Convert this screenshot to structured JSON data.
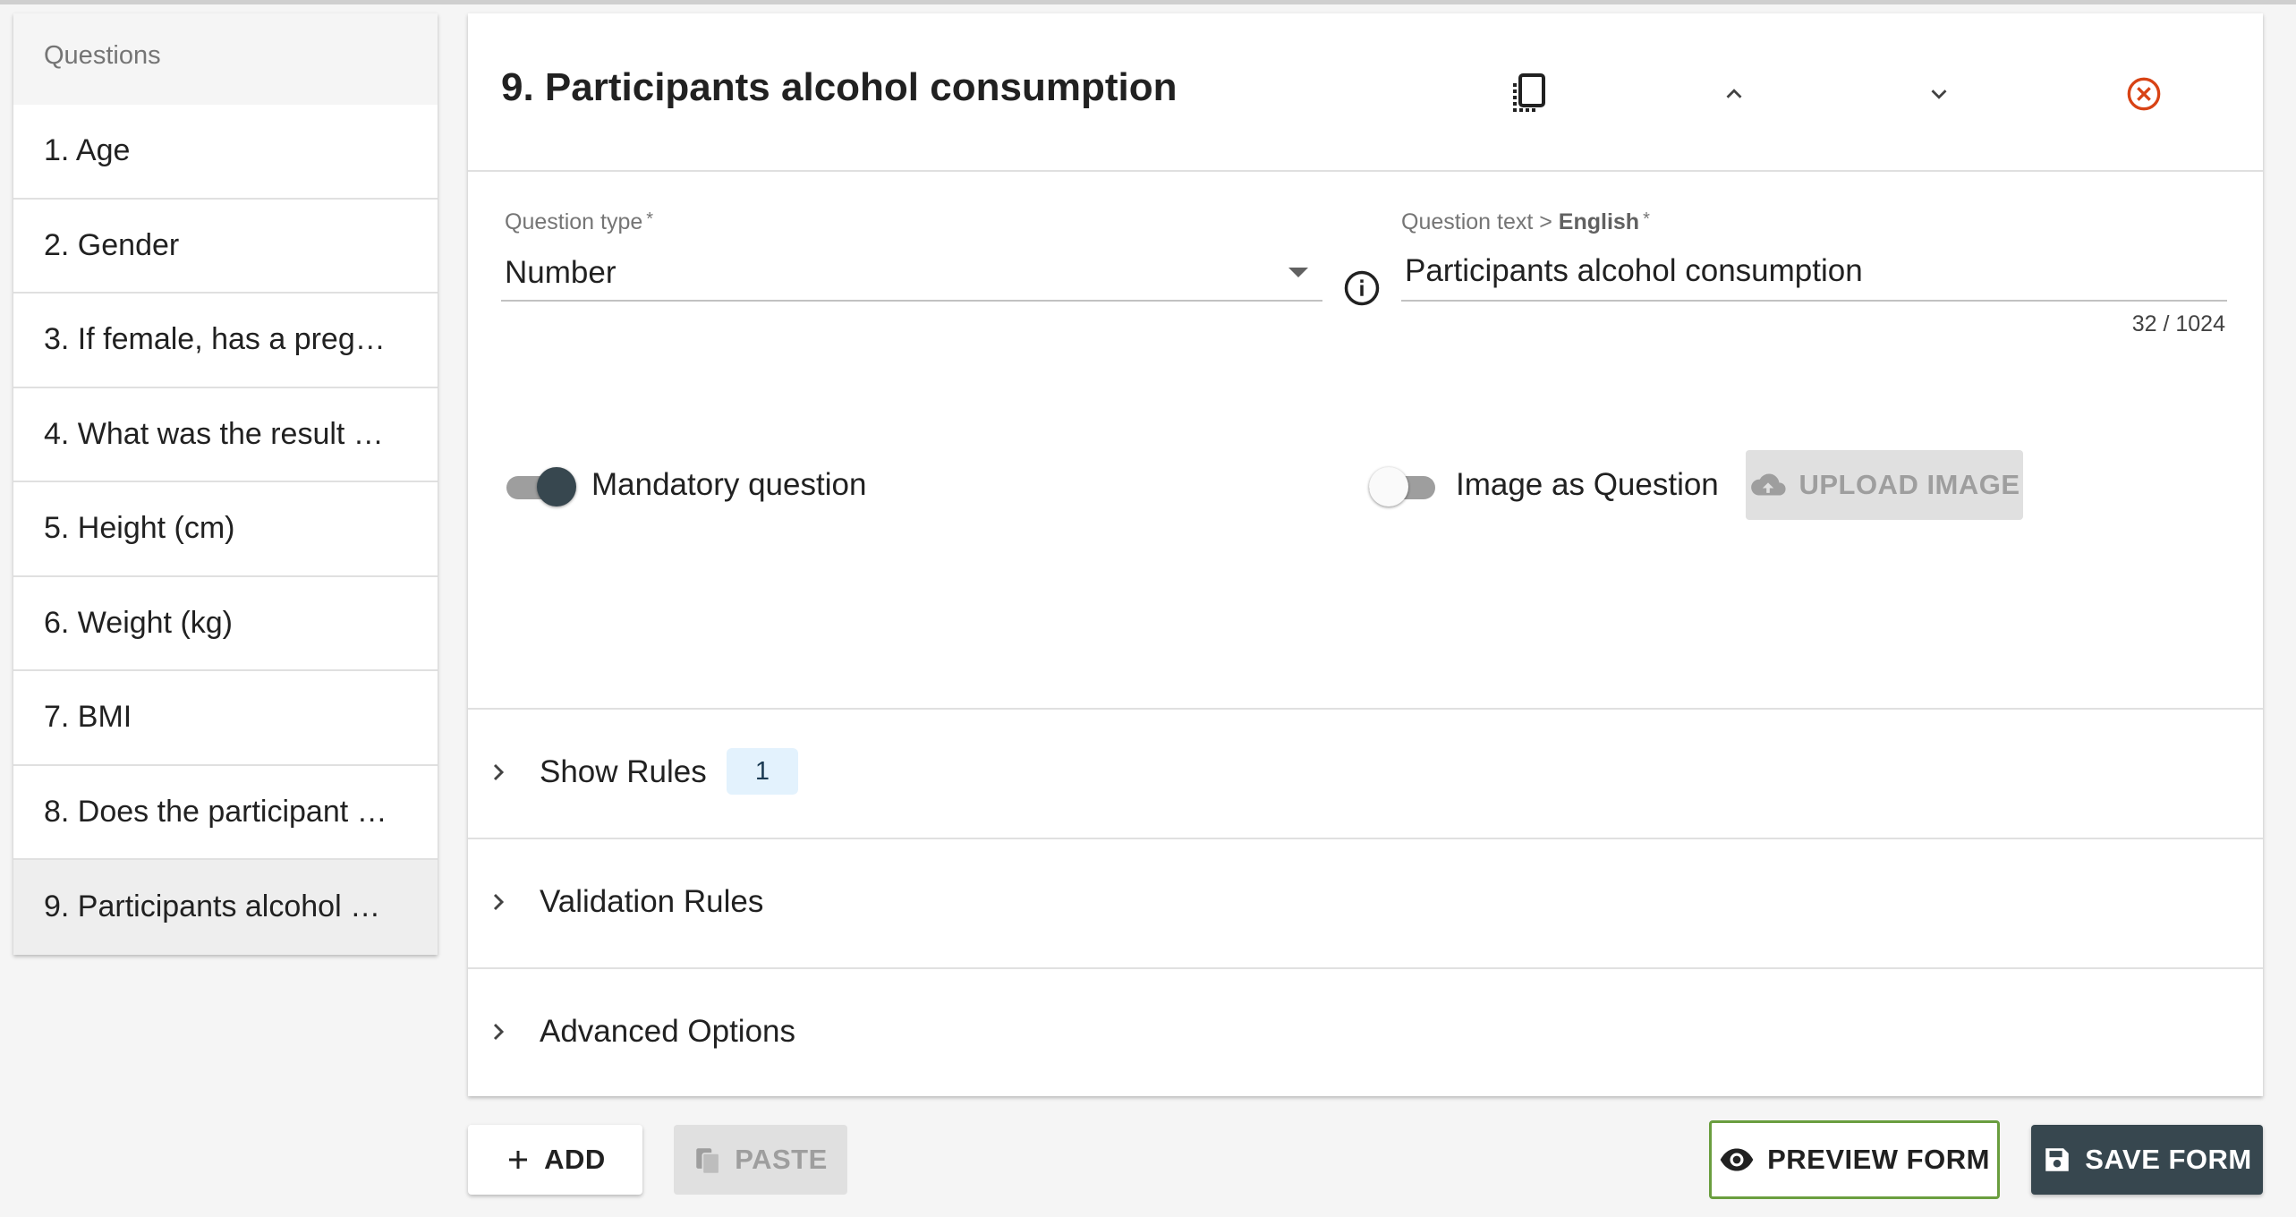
{
  "sidebar": {
    "header": "Questions",
    "items": [
      {
        "label": "1. Age"
      },
      {
        "label": "2. Gender"
      },
      {
        "label": "3. If female, has a preg…"
      },
      {
        "label": "4. What was the result …"
      },
      {
        "label": "5. Height (cm)"
      },
      {
        "label": "6. Weight (kg)"
      },
      {
        "label": "7. BMI"
      },
      {
        "label": "8. Does the participant …"
      },
      {
        "label": "9. Participants alcohol …"
      }
    ],
    "selected_index": 8
  },
  "question": {
    "title": "9. Participants alcohol consumption",
    "header_icons": [
      "copy-icon",
      "chevron-up-icon",
      "chevron-down-icon",
      "close-circle-icon"
    ],
    "type_label": "Question type",
    "type_required": "*",
    "type_value": "Number",
    "text_label_prefix": "Question text > ",
    "text_label_language": "English",
    "text_required": "*",
    "text_value": "Participants alcohol consumption",
    "char_counter": "32 / 1024",
    "mandatory_label": "Mandatory question",
    "mandatory_on": true,
    "image_as_question_label": "Image as Question",
    "image_as_question_on": false,
    "upload_image_label": "UPLOAD IMAGE"
  },
  "sections": {
    "show_rules": {
      "label": "Show Rules",
      "badge": "1"
    },
    "validation_rules": {
      "label": "Validation Rules"
    },
    "advanced_options": {
      "label": "Advanced Options"
    }
  },
  "actions": {
    "add": "ADD",
    "paste": "PASTE",
    "preview": "PREVIEW FORM",
    "save": "SAVE FORM"
  },
  "colors": {
    "accent_dark": "#37474f",
    "close_icon": "#d84315",
    "preview_outline": "#6a9e3f",
    "badge_bg": "#e3f2fd"
  }
}
